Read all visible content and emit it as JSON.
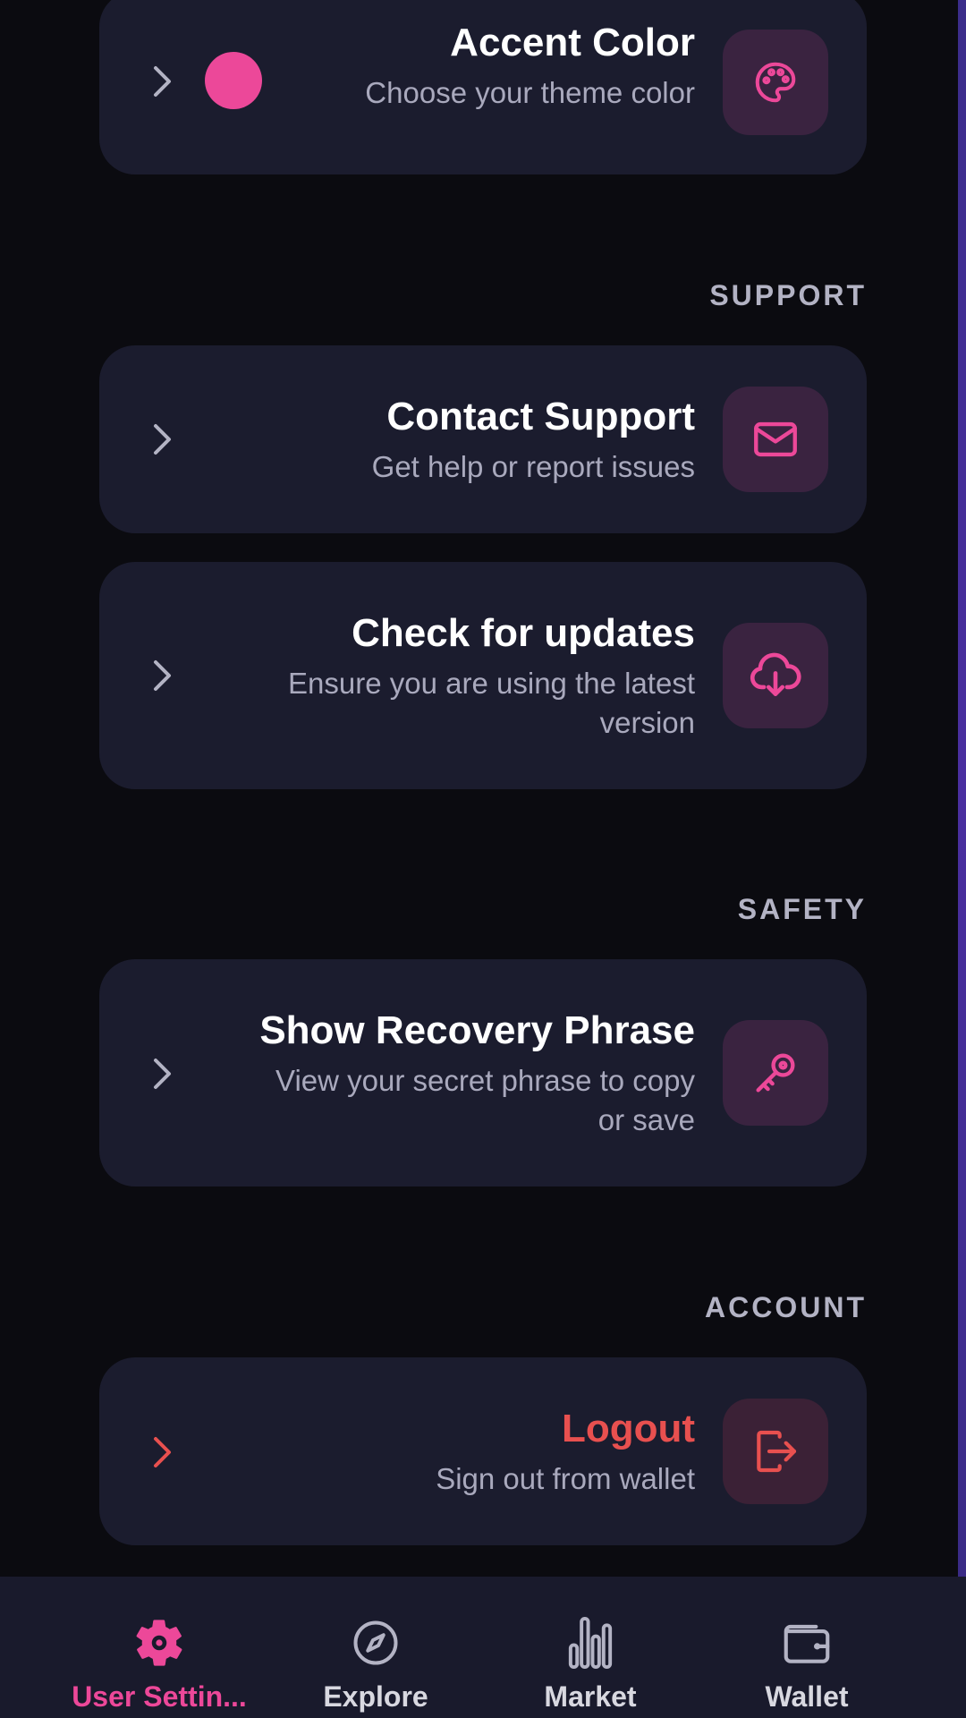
{
  "colors": {
    "accent": "#ec4899",
    "danger": "#e8504f",
    "card_bg": "#1b1c2e",
    "page_bg": "#0b0b10"
  },
  "appearance": {
    "accent_color": {
      "title": "Accent Color",
      "subtitle": "Choose your theme color",
      "selected_color": "#ec4899",
      "icon": "palette-icon"
    }
  },
  "support": {
    "section_label": "SUPPORT",
    "contact": {
      "title": "Contact Support",
      "subtitle": "Get help or report issues",
      "icon": "mail-icon"
    },
    "updates": {
      "title": "Check for updates",
      "subtitle_line1": "Ensure you are using the latest",
      "subtitle_line2": "version",
      "icon": "cloud-download-icon"
    }
  },
  "safety": {
    "section_label": "SAFETY",
    "recovery": {
      "title": "Show Recovery Phrase",
      "subtitle_line1": "View your secret phrase to copy",
      "subtitle_line2": "or save",
      "icon": "key-icon"
    }
  },
  "account": {
    "section_label": "ACCOUNT",
    "logout": {
      "title": "Logout",
      "subtitle": "Sign out from wallet",
      "icon": "logout-icon"
    }
  },
  "bottom_nav": {
    "items": [
      {
        "label": "User Settin...",
        "icon": "gear-icon",
        "active": true
      },
      {
        "label": "Explore",
        "icon": "compass-icon",
        "active": false
      },
      {
        "label": "Market",
        "icon": "bar-chart-icon",
        "active": false
      },
      {
        "label": "Wallet",
        "icon": "wallet-icon",
        "active": false
      }
    ]
  }
}
